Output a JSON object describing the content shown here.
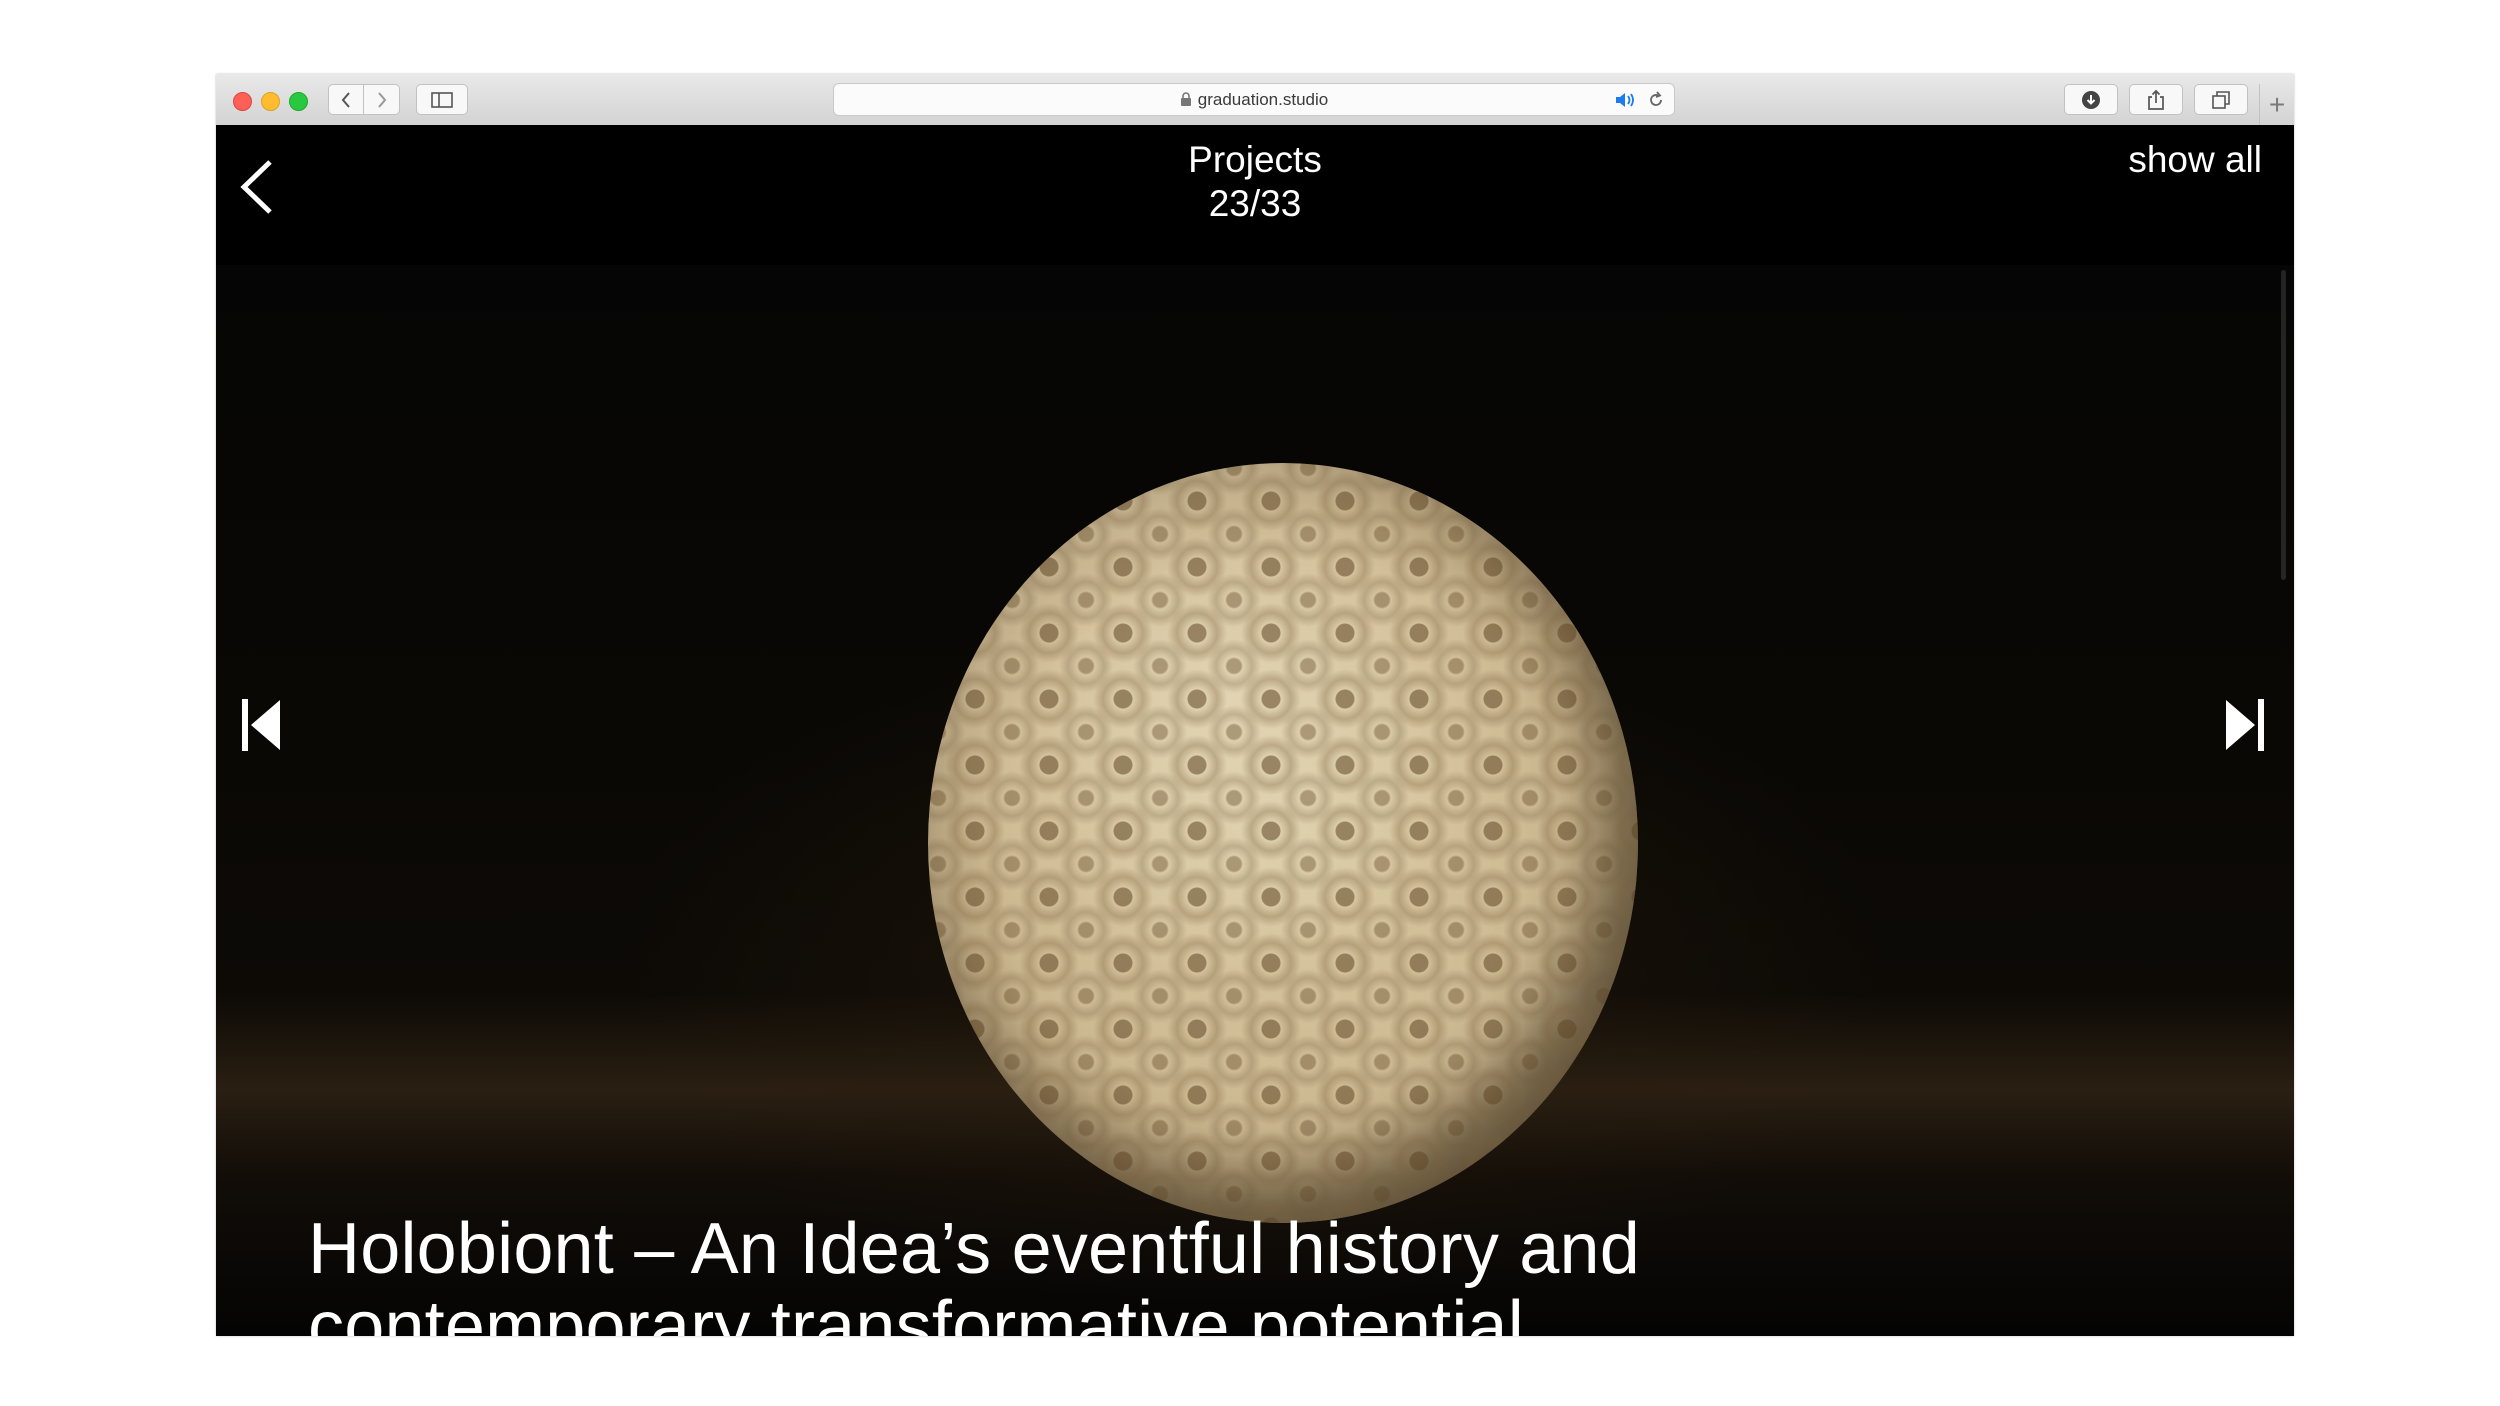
{
  "browser": {
    "url": "graduation.studio",
    "new_tab_label": "+"
  },
  "header": {
    "section_title": "Projects",
    "counter": "23/33",
    "show_all": "show all"
  },
  "project": {
    "title": "Holobiont – An Idea’s eventful history and contemporary transformative potential"
  },
  "colors": {
    "background": "#000000",
    "text": "#ffffff",
    "page_bg": "#ffffff"
  },
  "icons": {
    "back": "chevron-left-icon",
    "previous": "skip-previous-icon",
    "next": "skip-next-icon"
  }
}
